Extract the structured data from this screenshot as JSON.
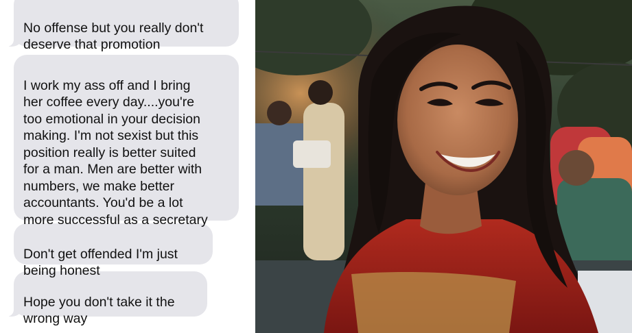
{
  "messages": [
    {
      "text": "No offense but you really don't\ndeserve that promotion"
    },
    {
      "text": "I work my ass off and I bring\nher coffee every day....you're\ntoo emotional in your decision\nmaking. I'm not sexist but this\nposition really is better suited\nfor a man. Men are better with\nnumbers, we make better\naccountants. You'd be a lot\nmore successful as a secretary"
    },
    {
      "text": "Don't get offended I'm just\nbeing honest"
    },
    {
      "text": "Hope you don't take it the\nwrong way"
    }
  ],
  "colors": {
    "bubble_background": "#e5e5ea",
    "bubble_text": "#111111",
    "chat_background": "#ffffff"
  }
}
